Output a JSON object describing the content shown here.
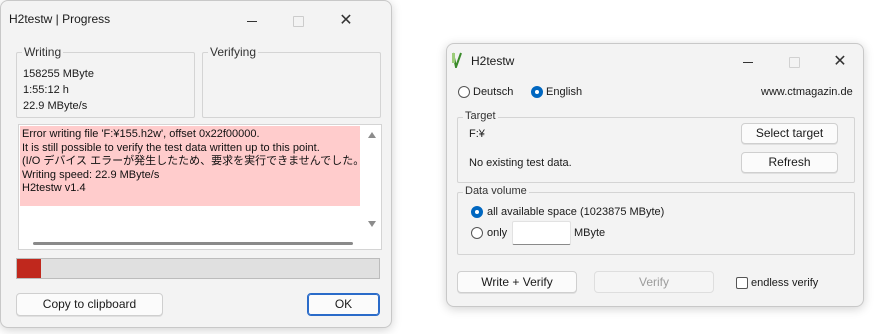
{
  "progress_window": {
    "title": "H2testw | Progress",
    "writing": {
      "label": "Writing",
      "size": "158255 MByte",
      "time": "1:55:12 h",
      "speed": "22.9 MByte/s"
    },
    "verifying": {
      "label": "Verifying"
    },
    "log_lines": [
      "Error writing file 'F:¥155.h2w', offset 0x22f00000.",
      "It is still possible to verify the test data written up to this point.",
      "(I/O デバイス エラーが発生したため、要求を実行できませんでした。Code",
      "Writing speed: 22.9 MByte/s",
      "H2testw v1.4"
    ],
    "progress_fraction": 0.065,
    "progress_color": "#c0281d",
    "log_highlight_color": "#ffcccc",
    "copy_button": "Copy to clipboard",
    "ok_button": "OK"
  },
  "main_window": {
    "title": "H2testw",
    "language": {
      "deutsch": "Deutsch",
      "english": "English",
      "selected": "English"
    },
    "website": "www.ctmagazin.de",
    "target": {
      "label": "Target",
      "drive": "F:¥",
      "status": "No existing test data.",
      "select_button": "Select target",
      "refresh_button": "Refresh"
    },
    "data_volume": {
      "label": "Data volume",
      "all_space": "all available space (1023875 MByte)",
      "only": "only",
      "only_value": "",
      "unit": "MByte",
      "selected": "all available space"
    },
    "write_verify_button": "Write + Verify",
    "verify_button": "Verify",
    "endless_verify": "endless verify",
    "endless_checked": false,
    "accent_color": "#0067c0"
  }
}
